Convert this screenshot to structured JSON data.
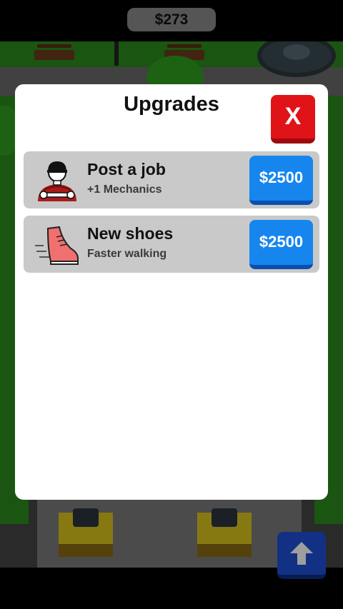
{
  "hud": {
    "money": "$273"
  },
  "modal": {
    "title": "Upgrades",
    "close_label": "X",
    "upgrades": [
      {
        "title": "Post a job",
        "subtitle": "+1 Mechanics",
        "price": "$2500",
        "icon": "mechanic-icon"
      },
      {
        "title": "New shoes",
        "subtitle": "Faster walking",
        "price": "$2500",
        "icon": "shoe-icon"
      }
    ]
  },
  "colors": {
    "close_button": "#e01418",
    "price_button": "#1686ee",
    "row_background": "#c9c9c9",
    "up_button": "#1d4fd6"
  }
}
